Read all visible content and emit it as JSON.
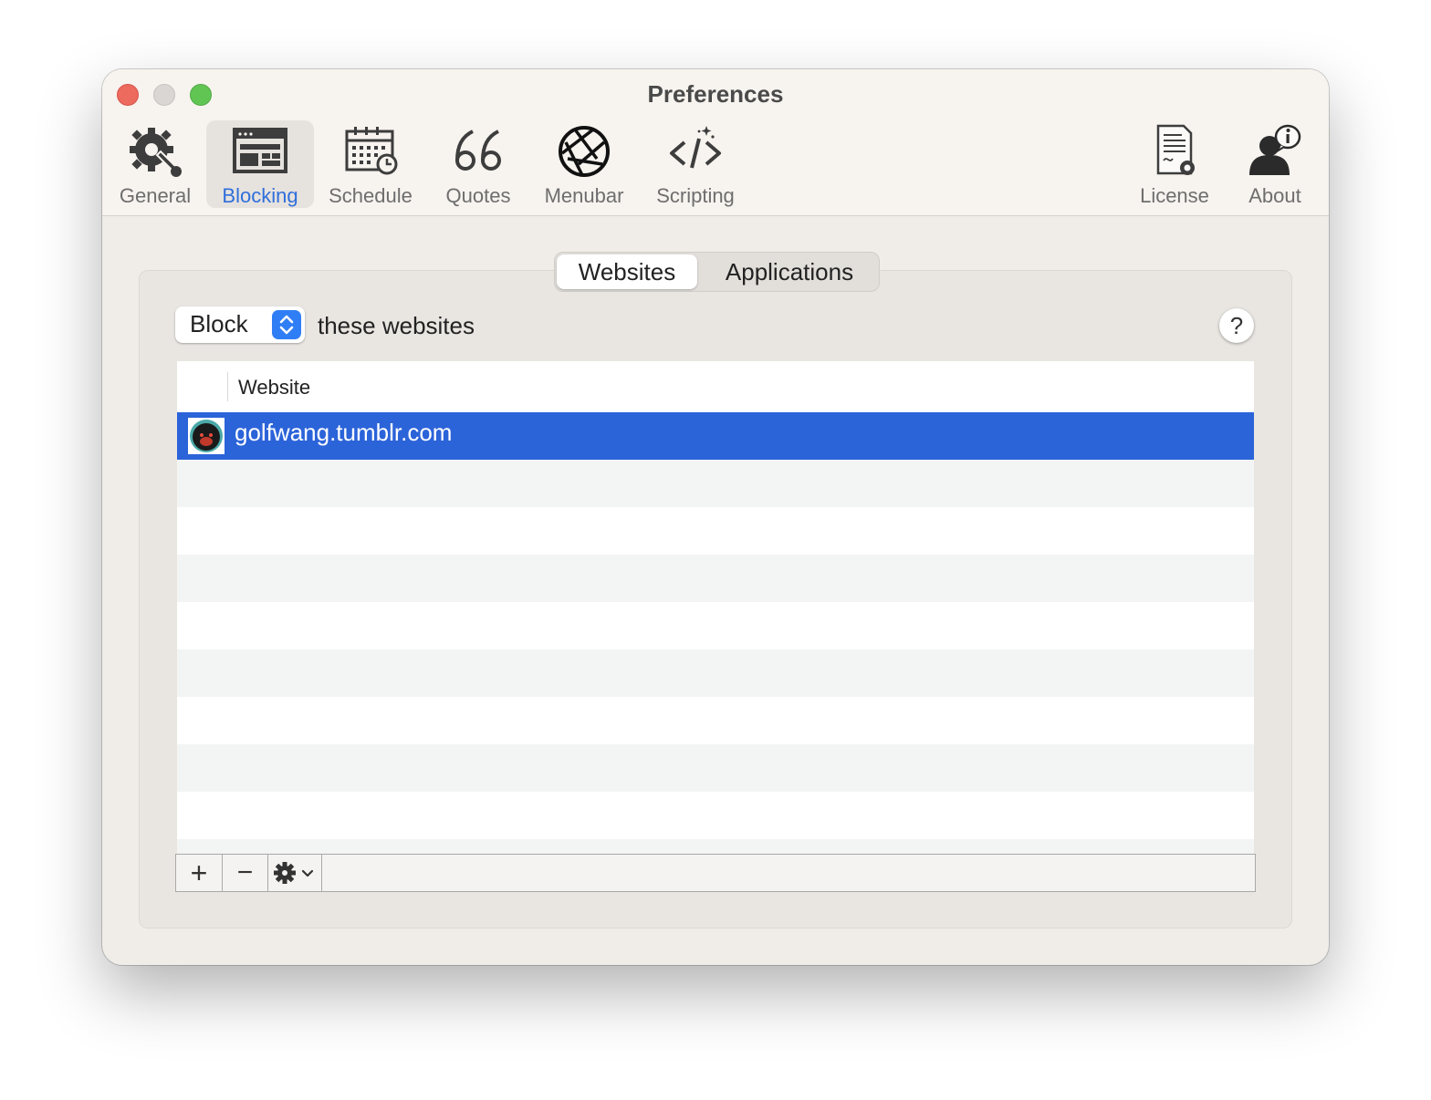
{
  "window": {
    "title": "Preferences"
  },
  "toolbar": {
    "items": [
      {
        "label": "General",
        "icon": "gear-wrench-icon",
        "selected": false
      },
      {
        "label": "Blocking",
        "icon": "blocking-window-icon",
        "selected": true
      },
      {
        "label": "Schedule",
        "icon": "calendar-clock-icon",
        "selected": false
      },
      {
        "label": "Quotes",
        "icon": "quote-marks-icon",
        "selected": false
      },
      {
        "label": "Menubar",
        "icon": "aperture-icon",
        "selected": false
      },
      {
        "label": "Scripting",
        "icon": "code-icon",
        "selected": false
      },
      {
        "label": "License",
        "icon": "license-certificate-icon",
        "selected": false
      },
      {
        "label": "About",
        "icon": "about-person-info-icon",
        "selected": false
      }
    ]
  },
  "tabs": [
    {
      "label": "Websites",
      "active": true
    },
    {
      "label": "Applications",
      "active": false
    }
  ],
  "mode_popup": {
    "value": "Block",
    "suffix": "these websites"
  },
  "help": {
    "label": "?"
  },
  "table": {
    "column_header": "Website",
    "rows": [
      {
        "site": "golfwang.tumblr.com",
        "icon": "tumblr-favicon-icon",
        "selected": true
      }
    ]
  },
  "bottom_bar": {
    "add_label": "+",
    "remove_label": "−",
    "actions_icon": "gear-menu-icon"
  },
  "colors": {
    "accent": "#2f6fdc",
    "selection": "#2b63d9",
    "window_bg": "#f0ede9"
  }
}
